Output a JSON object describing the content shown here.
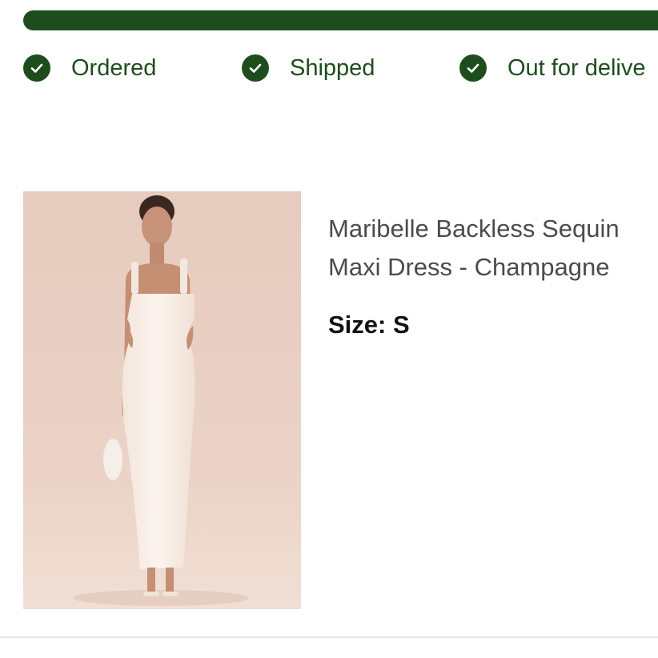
{
  "colors": {
    "accent": "#1e4d1d",
    "title_text": "#4b4b4b",
    "image_background": "#e8cfc3"
  },
  "tracking": {
    "progress": 1.0,
    "steps": [
      {
        "label": "Ordered",
        "icon": "checkmark-icon",
        "completed": true
      },
      {
        "label": "Shipped",
        "icon": "checkmark-icon",
        "completed": true
      },
      {
        "label": "Out for delive",
        "icon": "checkmark-icon",
        "completed": true
      }
    ]
  },
  "product": {
    "title": "Maribelle Backless Sequin Maxi Dress - Champagne",
    "size_label": "Size:",
    "size_value": "S"
  }
}
